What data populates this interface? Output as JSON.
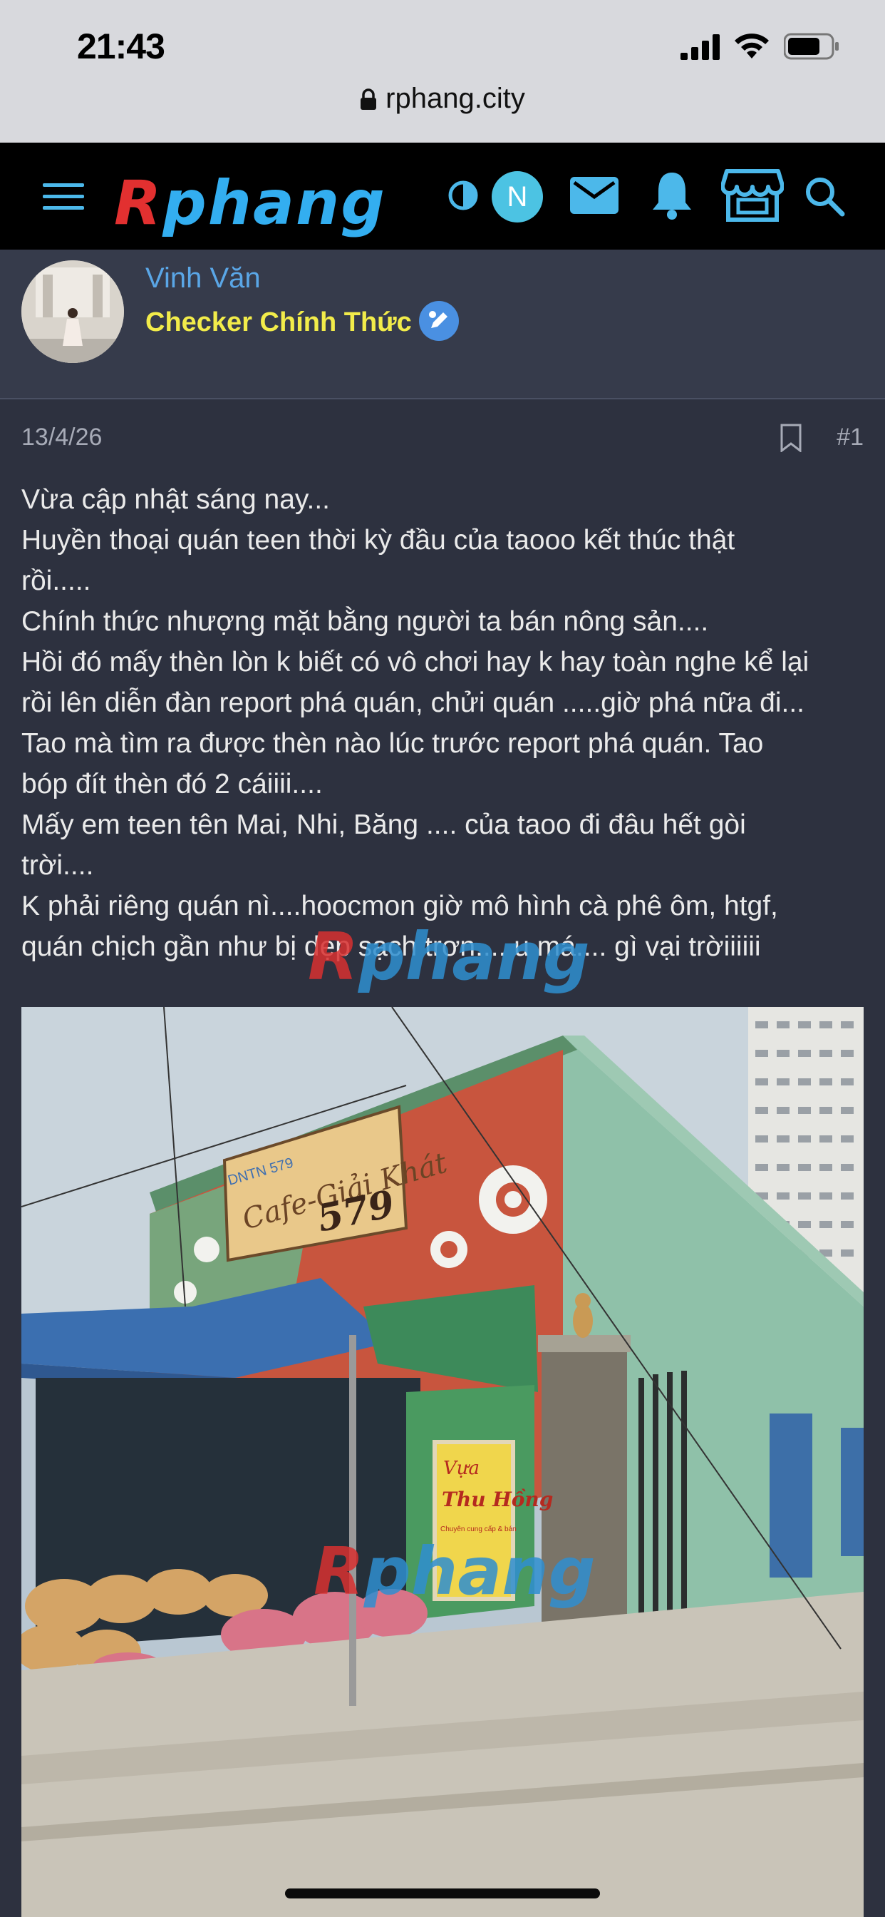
{
  "status_bar": {
    "time": "21:43"
  },
  "browser": {
    "url": "rphang.city"
  },
  "nav": {
    "logo_first": "R",
    "logo_rest": "phang",
    "user_initial": "N"
  },
  "author": {
    "name": "Vinh Văn",
    "title": "Checker Chính Thức"
  },
  "post": {
    "date": "13/4/26",
    "number": "#1",
    "lines": [
      "Vừa cập nhật sáng nay...",
      "Huyền thoại quán teen thời kỳ đầu của taooo kết thúc thật",
      "rồi.....",
      "Chính thức nhượng mặt bằng người ta bán nông sản....",
      "Hồi đó mấy thèn lòn k biết có vô chơi hay k hay toàn nghe kể lại",
      "rồi lên diễn đàn report phá quán, chửi quán .....giờ phá nữa đi...",
      "Tao mà tìm ra được thèn nào lúc trước report phá quán. Tao",
      "bóp đít thèn đó 2 cáiiii....",
      "Mấy em teen tên Mai, Nhi, Băng .... của taoo đi đâu hết gòi",
      "trời....",
      "K phải riêng quán nì....hoocmon giờ mô hình cà phê ôm, htgf,",
      "quán chịch gần như bị dẹp sạch trơn.... u má.... gì vại trờiiiiii"
    ]
  },
  "photo": {
    "sign_line1": "Cafe-Giải Khát",
    "sign_number": "579",
    "sign_small": "DNTN 579",
    "vendor_line1": "Vựa",
    "vendor_line2": "Thu Hồng",
    "vendor_line3": "Chuyên cung cấp & bán"
  },
  "watermark": {
    "first": "R",
    "rest": "phang"
  },
  "colors": {
    "page_bg": "#2d313f",
    "author_bg": "#363b4b",
    "username": "#5aa6e6",
    "usertitle": "#f2ec4a",
    "nav_icon": "#4cb8ea"
  }
}
